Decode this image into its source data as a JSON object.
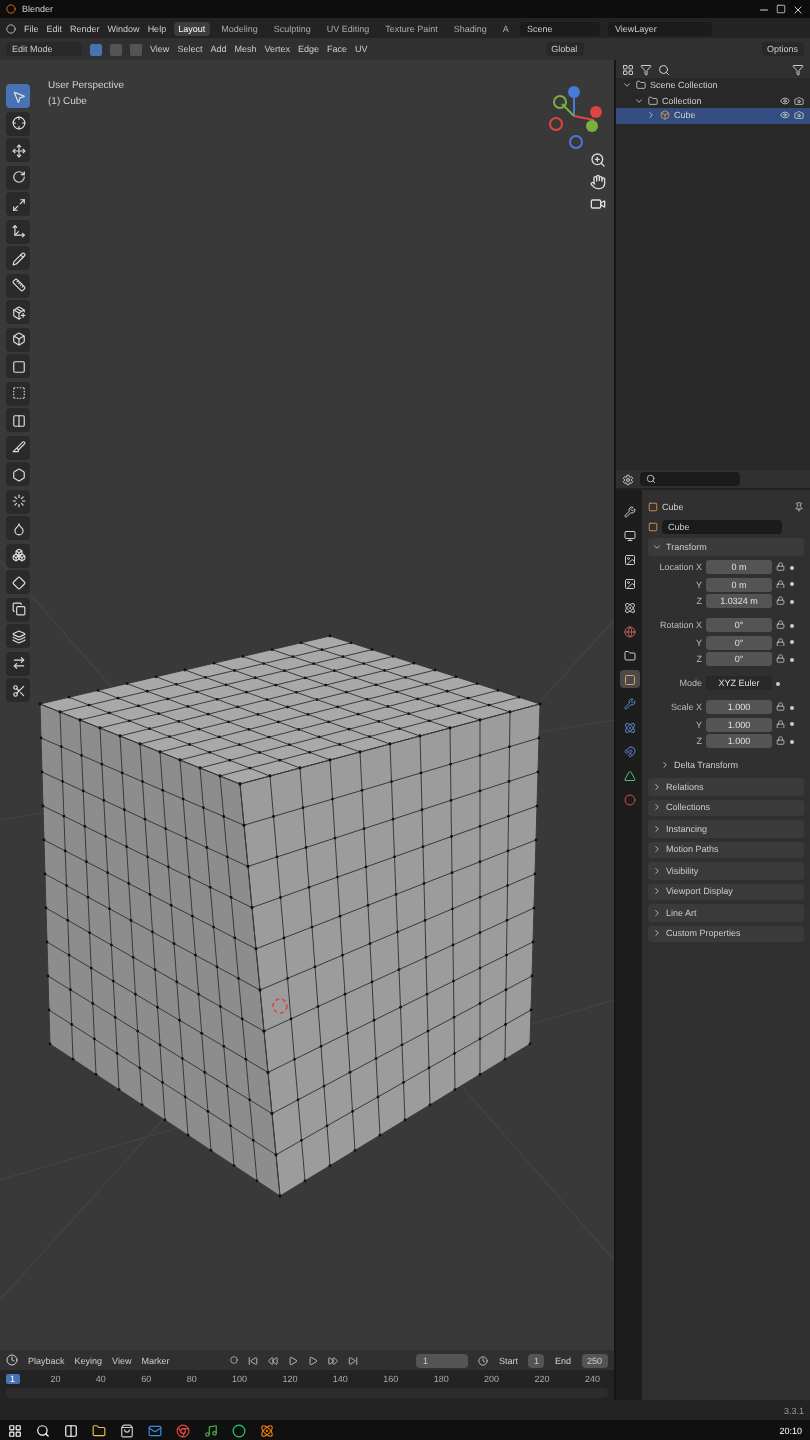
{
  "window": {
    "title": "Blender"
  },
  "menu": [
    "File",
    "Edit",
    "Render",
    "Window",
    "Help"
  ],
  "workspaces": [
    {
      "label": "Layout",
      "selected": true
    },
    {
      "label": "Modeling",
      "selected": false
    },
    {
      "label": "Sculpting",
      "selected": false
    },
    {
      "label": "UV Editing",
      "selected": false
    },
    {
      "label": "Texture Paint",
      "selected": false
    },
    {
      "label": "Shading",
      "selected": false
    },
    {
      "label": "A",
      "selected": false
    }
  ],
  "scene": "Scene",
  "view_layer": "ViewLayer",
  "header": {
    "mode": "Edit Mode",
    "select_modes": [
      {
        "selected": true
      },
      {
        "selected": false
      },
      {
        "selected": false
      }
    ],
    "menus": [
      "View",
      "Select",
      "Add",
      "Mesh",
      "Vertex",
      "Edge",
      "Face",
      "UV"
    ],
    "orientation": "Global",
    "options": "Options"
  },
  "toolbar": {
    "tools": [
      {
        "selected": true
      },
      {
        "selected": false
      },
      {
        "selected": false
      },
      {
        "selected": false
      },
      {
        "selected": false
      },
      {
        "selected": false
      },
      {
        "selected": false
      },
      {
        "selected": false
      },
      {
        "selected": false
      },
      {
        "selected": false
      },
      {
        "selected": false
      },
      {
        "selected": false
      },
      {
        "selected": false
      },
      {
        "selected": false
      },
      {
        "selected": false
      },
      {
        "selected": false
      },
      {
        "selected": false
      },
      {
        "selected": false
      },
      {
        "selected": false
      },
      {
        "selected": false
      },
      {
        "selected": false
      },
      {
        "selected": false
      },
      {
        "selected": false
      }
    ]
  },
  "viewport": {
    "view": "User Perspective",
    "object": "(1) Cube"
  },
  "outliner": {
    "items": [
      {
        "label": "Scene Collection",
        "selected": false,
        "children": [
          {
            "label": "Collection",
            "selected": false,
            "children": [
              {
                "label": "Cube",
                "selected": true
              }
            ]
          }
        ]
      }
    ]
  },
  "properties": {
    "tabs": [
      {
        "selected": false
      },
      {
        "selected": false
      },
      {
        "selected": false
      },
      {
        "selected": false
      },
      {
        "selected": false
      },
      {
        "selected": false
      },
      {
        "selected": false
      },
      {
        "selected": true
      },
      {
        "selected": false
      },
      {
        "selected": false
      },
      {
        "selected": false
      },
      {
        "selected": false
      },
      {
        "selected": false
      }
    ],
    "object_name": "Cube",
    "name_field": "Cube",
    "transform": {
      "title": "Transform",
      "expanded": true,
      "groups": [
        {
          "rows": [
            {
              "kind": "number",
              "label": "Location X",
              "value": "0 m"
            },
            {
              "kind": "number",
              "label": "Y",
              "value": "0 m"
            },
            {
              "kind": "number",
              "label": "Z",
              "value": "1.0324 m"
            }
          ]
        },
        {
          "rows": [
            {
              "kind": "number",
              "label": "Rotation X",
              "value": "0°"
            },
            {
              "kind": "number",
              "label": "Y",
              "value": "0°"
            },
            {
              "kind": "number",
              "label": "Z",
              "value": "0°"
            }
          ]
        },
        {
          "rows": [
            {
              "kind": "dropdown",
              "label": "Mode",
              "value": "XYZ Euler"
            }
          ]
        },
        {
          "rows": [
            {
              "kind": "number",
              "label": "Scale X",
              "value": "1.000"
            },
            {
              "kind": "number",
              "label": "Y",
              "value": "1.000"
            },
            {
              "kind": "number",
              "label": "Z",
              "value": "1.000"
            }
          ]
        }
      ],
      "subpanels": [
        {
          "label": "Delta Transform",
          "expanded": false
        }
      ]
    },
    "panels": [
      {
        "label": "Relations",
        "expanded": false
      },
      {
        "label": "Collections",
        "expanded": false
      },
      {
        "label": "Instancing",
        "expanded": false
      },
      {
        "label": "Motion Paths",
        "expanded": false
      },
      {
        "label": "Visibility",
        "expanded": false
      },
      {
        "label": "Viewport Display",
        "expanded": false
      },
      {
        "label": "Line Art",
        "expanded": false
      },
      {
        "label": "Custom Properties",
        "expanded": false
      }
    ]
  },
  "timeline": {
    "menus": [
      "Playback",
      "Keying",
      "View",
      "Marker"
    ],
    "current_frame": "1",
    "start_label": "Start",
    "start": "1",
    "end_label": "End",
    "end": "250",
    "ruler": [
      {
        "label": "1",
        "selected": true
      },
      {
        "label": "20",
        "selected": false
      },
      {
        "label": "40",
        "selected": false
      },
      {
        "label": "60",
        "selected": false
      },
      {
        "label": "80",
        "selected": false
      },
      {
        "label": "100",
        "selected": false
      },
      {
        "label": "120",
        "selected": false
      },
      {
        "label": "140",
        "selected": false
      },
      {
        "label": "160",
        "selected": false
      },
      {
        "label": "180",
        "selected": false
      },
      {
        "label": "200",
        "selected": false
      },
      {
        "label": "220",
        "selected": false
      },
      {
        "label": "240",
        "selected": false
      }
    ]
  },
  "status_bar": {
    "version": "3.3.1"
  },
  "taskbar": {
    "clock": "20:10"
  }
}
